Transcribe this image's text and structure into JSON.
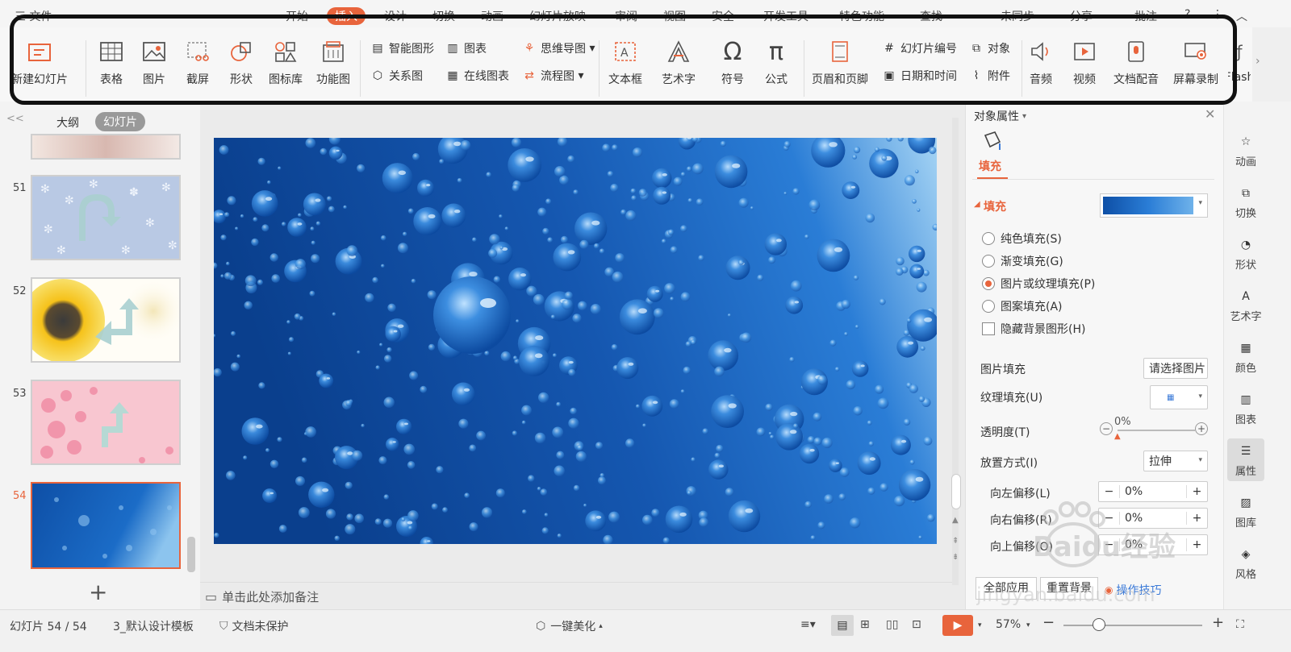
{
  "menubar": {
    "items": [
      "三 文件",
      "开始",
      "插入",
      "设计",
      "切换",
      "动画",
      "幻灯片放映",
      "审阅",
      "视图",
      "安全",
      "开发工具",
      "特色功能",
      "查找",
      "未同步",
      "分享",
      "批注"
    ],
    "active_index": 2
  },
  "ribbon": {
    "new_slide": "新建幻灯片",
    "table": "表格",
    "picture": "图片",
    "screenshot": "截屏",
    "shape": "形状",
    "icon_lib": "图标库",
    "function_chart": "功能图",
    "smart_art": "智能图形",
    "chart": "图表",
    "relation": "关系图",
    "online_chart": "在线图表",
    "mind_map": "思维导图",
    "flowchart": "流程图",
    "textbox": "文本框",
    "wordart": "艺术字",
    "symbol": "符号",
    "formula": "公式",
    "header_footer": "页眉和页脚",
    "slide_number": "幻灯片编号",
    "object": "对象",
    "date_time": "日期和时间",
    "attachment": "附件",
    "audio": "音频",
    "video": "视频",
    "doc_dub": "文档配音",
    "screen_rec": "屏幕录制",
    "flash": "Flash"
  },
  "left_panel": {
    "tab_outline": "大纲",
    "tab_slides": "幻灯片",
    "collapse": "<<",
    "slides": [
      {
        "num": "51"
      },
      {
        "num": "52"
      },
      {
        "num": "53"
      },
      {
        "num": "54",
        "selected": true
      }
    ],
    "add_slide": "+"
  },
  "canvas": {
    "notes_placeholder": "单击此处添加备注"
  },
  "right_panel": {
    "title": "对象属性",
    "tab_fill": "填充",
    "section_fill": "填充",
    "options": [
      {
        "label": "纯色填充(S)",
        "checked": false
      },
      {
        "label": "渐变填充(G)",
        "checked": false
      },
      {
        "label": "图片或纹理填充(P)",
        "checked": true
      },
      {
        "label": "图案填充(A)",
        "checked": false
      }
    ],
    "hide_bg": "隐藏背景图形(H)",
    "picture_fill_label": "图片填充",
    "picture_fill_value": "请选择图片",
    "texture_fill_label": "纹理填充(U)",
    "transparency_label": "透明度(T)",
    "transparency_value": "0%",
    "placement_label": "放置方式(I)",
    "placement_value": "拉伸",
    "offset_left_label": "向左偏移(L)",
    "offset_left_value": "0%",
    "offset_right_label": "向右偏移(R)",
    "offset_right_value": "0%",
    "offset_top_label": "向上偏移(O)",
    "offset_top_value": "0%",
    "apply_all": "全部应用",
    "reset_bg": "重置背景",
    "tips": "操作技巧"
  },
  "sidebar": {
    "items": [
      "动画",
      "切换",
      "形状",
      "艺术字",
      "颜色",
      "图表",
      "属性",
      "图库",
      "风格"
    ],
    "active_index": 6
  },
  "statusbar": {
    "slide_pos": "幻灯片 54 / 54",
    "template": "3_默认设计模板",
    "protect": "文档未保护",
    "beautify": "一键美化",
    "zoom": "57%"
  },
  "watermark": {
    "brand": "Baidu经验",
    "url": "jingyan.baidu.com"
  },
  "colors": {
    "accent": "#e8643c",
    "slide_blue": "#1f63b8"
  }
}
